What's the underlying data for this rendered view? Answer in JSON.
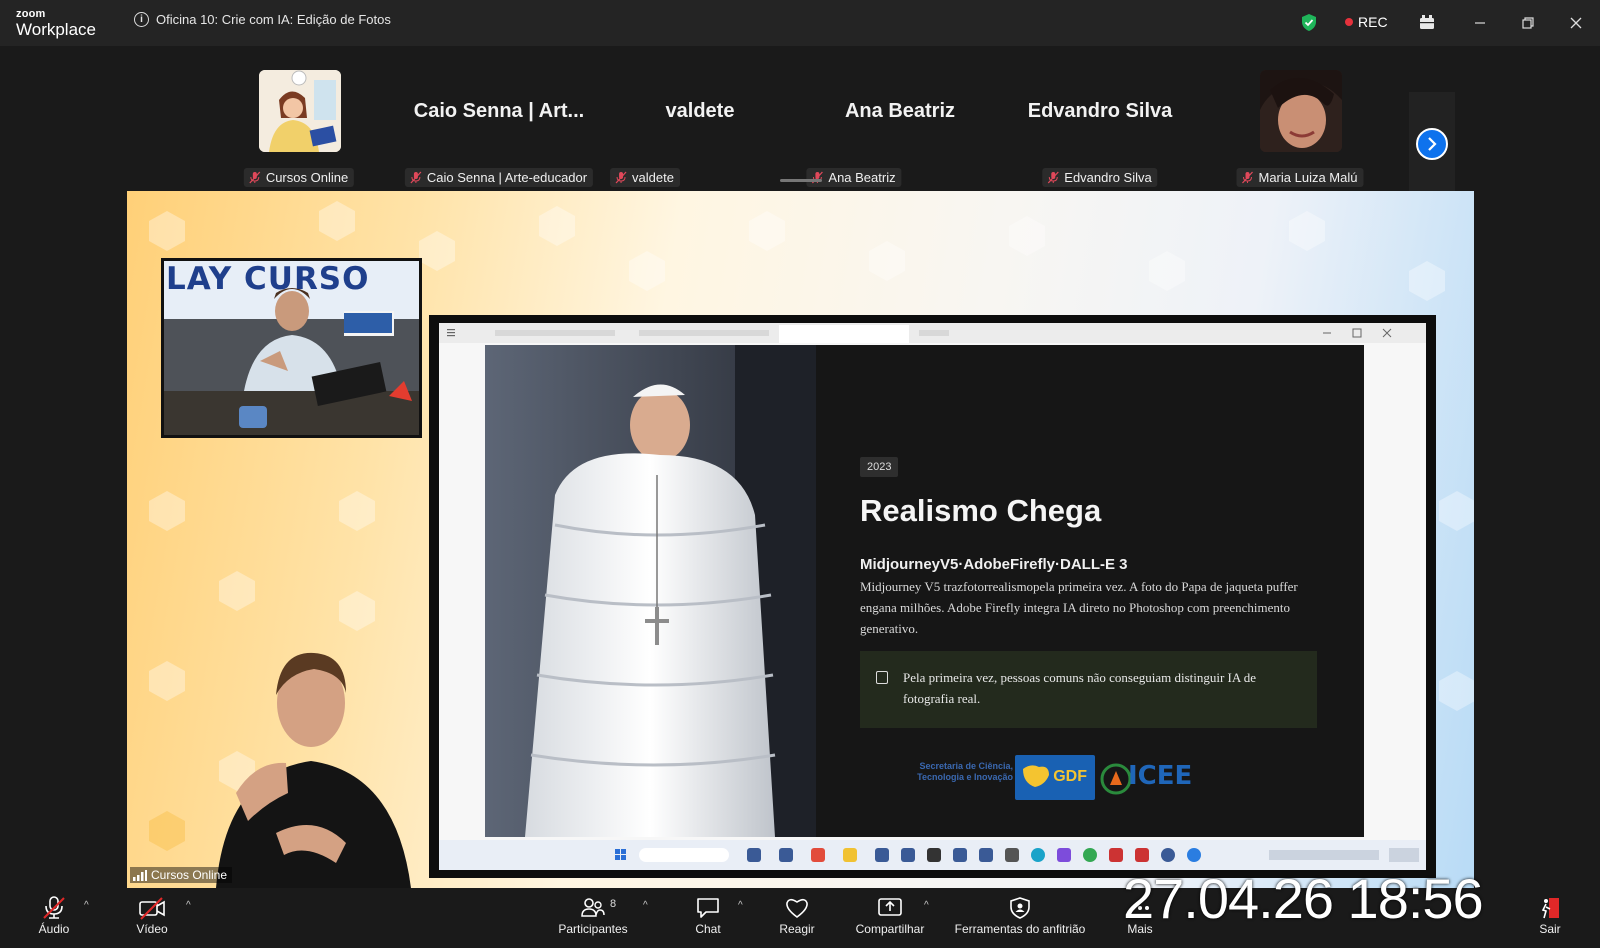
{
  "app": {
    "brand_top": "zoom",
    "brand_bottom": "Workplace"
  },
  "meeting": {
    "title": "Oficina 10: Crie com IA: Edição de Fotos",
    "rec_label": "REC"
  },
  "participants": [
    {
      "display": "",
      "tag": "Cursos Online",
      "kind": "avatar"
    },
    {
      "display": "Caio Senna | Art...",
      "tag": "Caio Senna | Arte-educador",
      "kind": "name"
    },
    {
      "display": "valdete",
      "tag": "valdete",
      "kind": "name"
    },
    {
      "display": "Ana Beatriz",
      "tag": "Ana Beatriz",
      "kind": "name"
    },
    {
      "display": "Edvandro Silva",
      "tag": "Edvandro Silva",
      "kind": "name"
    },
    {
      "display": "",
      "tag": "Maria Luiza Malú",
      "kind": "photo"
    }
  ],
  "share": {
    "camera_banner": "LAY CURSO",
    "camera_label": "Cursos Online",
    "slide": {
      "badge": "2023",
      "title": "Realismo Chega",
      "subtitle": "MidjourneyV5·AdobeFirefly·DALL-E 3",
      "body": "Midjourney V5 trazfotorrealismopela primeira vez. A foto do Papa de jaqueta puffer engana milhões. Adobe Firefly integra IA direto no Photoshop com preenchimento generativo.",
      "note": "Pela primeira vez, pessoas comuns não conseguiam distinguir IA de fotografia real.",
      "logo_sec": "Secretaria de Ciência, Tecnologia e Inovação",
      "logo_gdf": "GDF",
      "logo_icee": "ICEE"
    }
  },
  "toolbar": {
    "audio": "Áudio",
    "video": "Vídeo",
    "participants": "Participantes",
    "participants_count": "8",
    "chat": "Chat",
    "react": "Reagir",
    "share": "Compartilhar",
    "host_tools": "Ferramentas do anfitrião",
    "more": "Mais",
    "leave": "Sair"
  },
  "overlay_clock": "27.04.26 18:56",
  "colors": {
    "accent": "#0e72ed",
    "rec": "#e6323c",
    "shield": "#1fb55a",
    "leave": "#e02828"
  }
}
